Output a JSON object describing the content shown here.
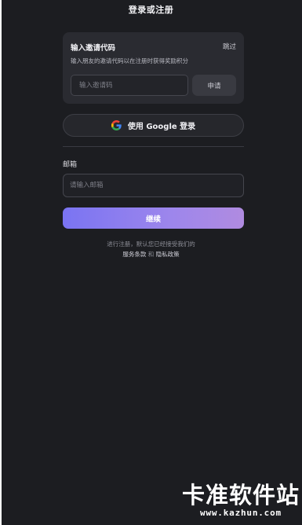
{
  "page_title": "登录或注册",
  "invite": {
    "title": "输入邀请代码",
    "skip_label": "跳过",
    "description": "输入朋友的邀请代码以在注册时获得奖励积分",
    "input_placeholder": "输入邀请码",
    "input_value": "",
    "apply_label": "申请"
  },
  "google": {
    "label": "使用 Google 登录",
    "icon": "google-icon"
  },
  "email": {
    "label": "邮箱",
    "placeholder": "请输入邮箱",
    "value": ""
  },
  "continue_label": "继续",
  "terms": {
    "prefix": "进行注册，默认您已经接受我们的",
    "terms_link": "服务条款",
    "conjunction": "和",
    "privacy_link": "隐私政策"
  },
  "watermark": {
    "title": "卡准软件站",
    "url": "www.kazhun.com"
  },
  "colors": {
    "background": "#1c1d21",
    "card": "#2a2b31",
    "accent_start": "#7a74f2",
    "accent_end": "#b08be0",
    "google_blue": "#4285F4",
    "google_red": "#EA4335",
    "google_yellow": "#FBBC05",
    "google_green": "#34A853"
  }
}
